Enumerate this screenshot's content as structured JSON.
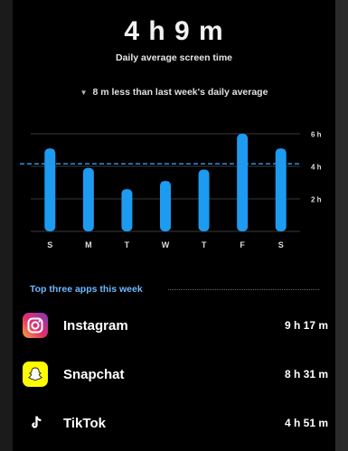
{
  "summary": {
    "total": "4 h 9 m",
    "subtitle": "Daily average screen time",
    "comparison": "8 m less than last week's daily average"
  },
  "chart_data": {
    "type": "bar",
    "categories": [
      "S",
      "M",
      "T",
      "W",
      "T",
      "F",
      "S"
    ],
    "values": [
      5.1,
      3.9,
      2.6,
      3.1,
      3.8,
      6.0,
      5.1
    ],
    "unit": "h",
    "ylim": [
      0,
      6
    ],
    "yticks": [
      {
        "value": 6,
        "label": "6 h"
      },
      {
        "value": 4,
        "label": "4 h"
      },
      {
        "value": 2,
        "label": "2 h"
      }
    ],
    "average": 4.15,
    "grid": true,
    "bar_color": "#1d9bf0"
  },
  "top_apps": {
    "title": "Top three apps this week",
    "items": [
      {
        "name": "Instagram",
        "time": "9 h 17 m",
        "icon": "instagram-icon"
      },
      {
        "name": "Snapchat",
        "time": "8 h 31 m",
        "icon": "snapchat-icon"
      },
      {
        "name": "TikTok",
        "time": "4 h 51 m",
        "icon": "tiktok-icon"
      }
    ]
  }
}
